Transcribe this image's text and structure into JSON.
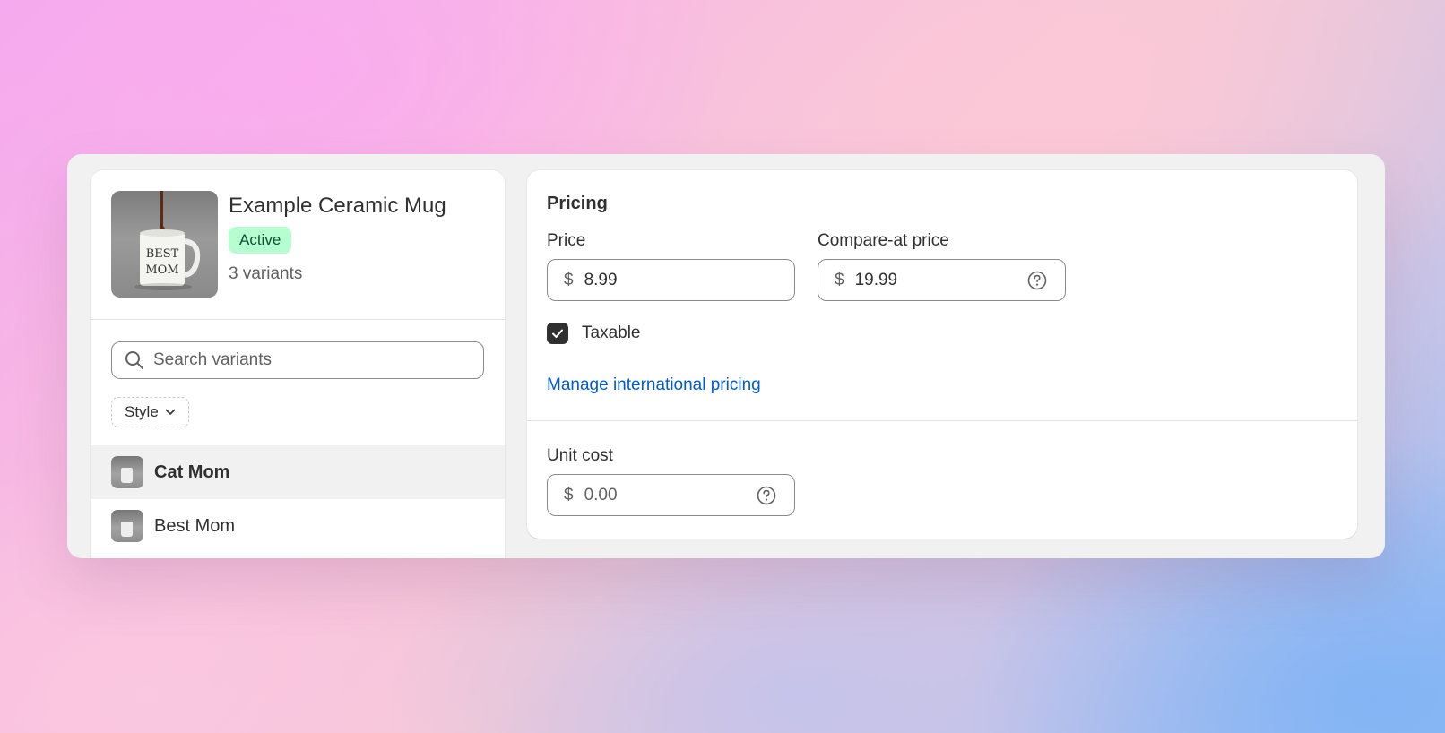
{
  "product": {
    "title": "Example Ceramic Mug",
    "status": "Active",
    "variant_count": "3 variants",
    "image_text": "BEST MOM"
  },
  "variant_panel": {
    "search_placeholder": "Search variants",
    "filter_label": "Style",
    "variants": [
      {
        "name": "Cat Mom",
        "selected": true
      },
      {
        "name": "Best Mom",
        "selected": false
      }
    ]
  },
  "pricing": {
    "title": "Pricing",
    "price_label": "Price",
    "currency_symbol": "$",
    "price_value": "8.99",
    "compare_label": "Compare-at price",
    "compare_value": "19.99",
    "taxable_label": "Taxable",
    "taxable_checked": true,
    "international_link": "Manage international pricing",
    "unit_cost_label": "Unit cost",
    "unit_cost_placeholder": "0.00"
  },
  "colors": {
    "status_badge_bg": "#b4fed2",
    "status_badge_text": "#0c5132",
    "link": "#005bd3"
  }
}
